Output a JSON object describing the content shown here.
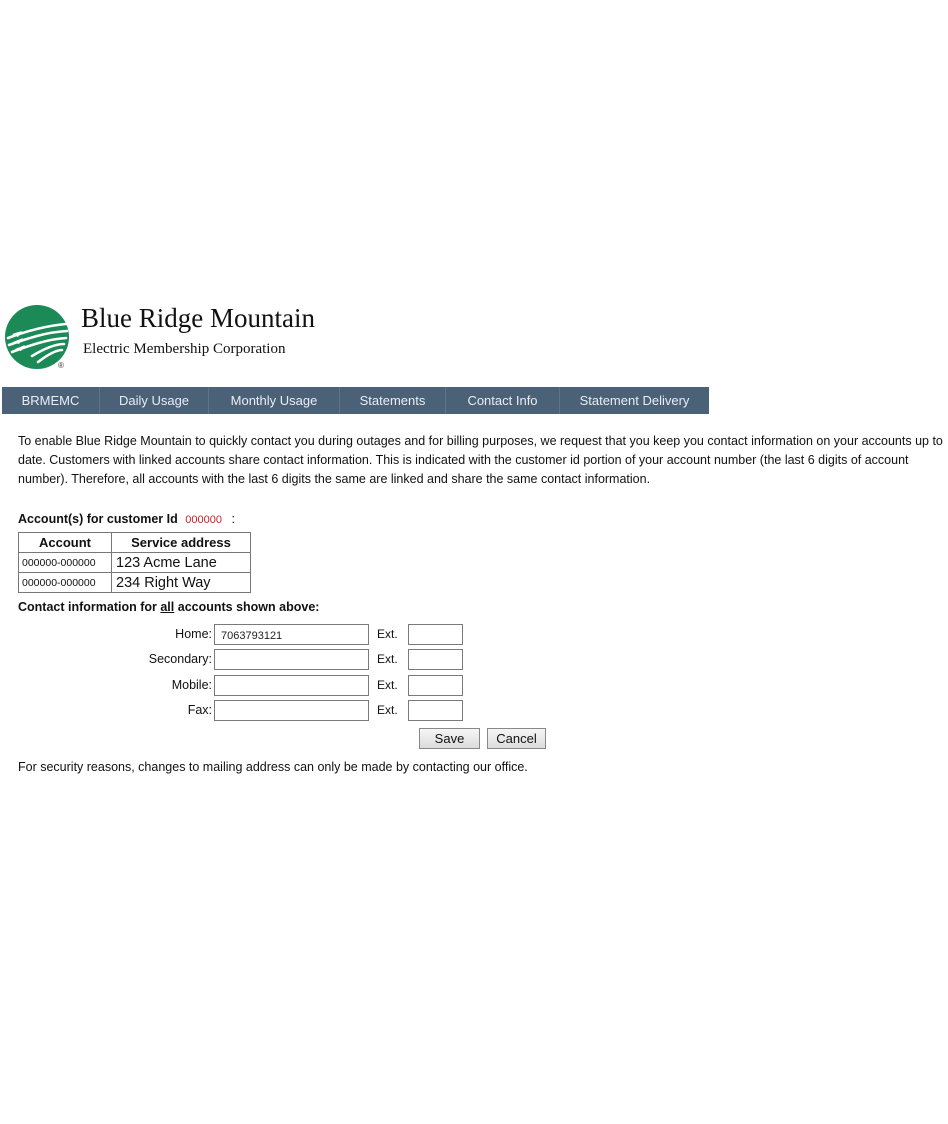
{
  "brand": {
    "title": "Blue Ridge Mountain",
    "subtitle": "Electric Membership Corporation",
    "registered_mark": "®",
    "logo_color": "#1b8a57"
  },
  "nav": {
    "items": [
      {
        "label": "BRMEMC"
      },
      {
        "label": "Daily Usage"
      },
      {
        "label": "Monthly Usage"
      },
      {
        "label": "Statements"
      },
      {
        "label": "Contact Info"
      },
      {
        "label": "Statement Delivery"
      }
    ],
    "background": "#4b6178"
  },
  "intro_text": "To enable Blue Ridge Mountain to quickly contact you during outages and for billing purposes, we request that you keep you contact information on your accounts up to date. Customers with linked accounts share contact information. This is indicated with the customer id portion of your account number (the last 6 digits of account number). Therefore, all accounts with the last 6 digits the same are linked and share the same contact information.",
  "accounts": {
    "heading": "Account(s) for customer Id",
    "customer_id": "000000",
    "colon": ":",
    "columns": [
      "Account",
      "Service address"
    ],
    "rows": [
      {
        "account": "000000-000000",
        "address": "123 Acme Lane"
      },
      {
        "account": "000000-000000",
        "address": "234 Right Way"
      }
    ]
  },
  "contact": {
    "heading_pre": "Contact information for ",
    "heading_em": "all",
    "heading_post": " accounts shown above:",
    "ext_label": "Ext.",
    "fields": [
      {
        "label": "Home:",
        "value": "7063793121",
        "ext": ""
      },
      {
        "label": "Secondary:",
        "value": "",
        "ext": ""
      },
      {
        "label": "Mobile:",
        "value": "",
        "ext": ""
      },
      {
        "label": "Fax:",
        "value": "",
        "ext": ""
      }
    ],
    "save_label": "Save",
    "cancel_label": "Cancel"
  },
  "footer_note": "For security reasons, changes to mailing address can only be made by contacting our office."
}
